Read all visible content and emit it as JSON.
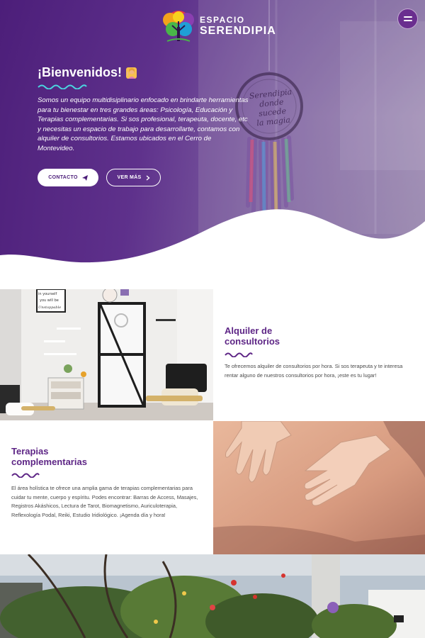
{
  "header": {
    "logo_line1": "ESPACIO",
    "logo_line2": "SERENDIPIA",
    "menu_icon": "hamburger-icon"
  },
  "hero": {
    "title": "¡Bienvenidos!",
    "intro": "Somos un equipo multidisiplinario enfocado en brindarte herramientas para tu bienestar en tres grandes áreas: Psicología, Educación y Terapias complementarias. Si sos profesional, terapeuta, docente, etc y necesitas un espacio de trabajo para desarrollarte, contamos con alquiler de consultorios. Estamos ubicados en el Cerro de Montevideo.",
    "contact_label": "CONTACTO",
    "more_label": "VER MÁS",
    "sign_line1": "Serendipia",
    "sign_line2": "donde sucede",
    "sign_line3": "la magia"
  },
  "rental": {
    "title": "Alquiler de consultorios",
    "text": "Te ofrecemos alquiler de consultorios por hora. Si sos terapeuta y te interesa rentar alguno de nuestros consultorios por hora, ¡este es tu lugar!",
    "poster_text": "in yourself and you will be Unstoppable"
  },
  "therapies": {
    "title": "Terapias complementarias",
    "text": "El área holística te ofrece una amplia gama de terapias complementarias para cuidar tu mente, cuerpo y espíritu. Podes encontrar: Barras de Access, Masajes, Registros Akáshicos, Lectura de Tarot, Biomagnetismo, Auriculoterapia, Reflexología Podal, Reiki, Estudio Iridiológico. ¡Agenda día y hora!"
  },
  "colors": {
    "primary": "#5e2686",
    "hero": "#4a1b78",
    "squiggle": "#4ad6e0"
  }
}
